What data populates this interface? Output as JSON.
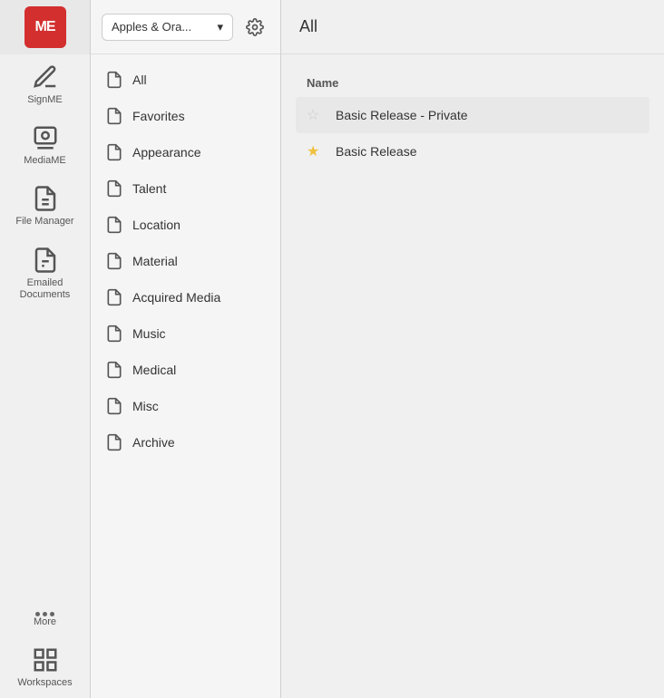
{
  "logo": {
    "text": "ME"
  },
  "sidebar": {
    "items": [
      {
        "id": "sign-me",
        "label": "SignME",
        "icon": "pen"
      },
      {
        "id": "media-me",
        "label": "MediaME",
        "icon": "media"
      },
      {
        "id": "file-manager",
        "label": "File Manager",
        "icon": "file"
      },
      {
        "id": "emailed-documents",
        "label": "Emailed Documents",
        "icon": "email-doc"
      },
      {
        "id": "more",
        "label": "More",
        "icon": "more"
      },
      {
        "id": "workspaces",
        "label": "Workspaces",
        "icon": "grid"
      }
    ]
  },
  "workspace": {
    "name": "Apples & Ora...",
    "settings_label": "settings"
  },
  "menu": {
    "items": [
      {
        "id": "all",
        "label": "All"
      },
      {
        "id": "favorites",
        "label": "Favorites"
      },
      {
        "id": "appearance",
        "label": "Appearance"
      },
      {
        "id": "talent",
        "label": "Talent"
      },
      {
        "id": "location",
        "label": "Location"
      },
      {
        "id": "material",
        "label": "Material"
      },
      {
        "id": "acquired-media",
        "label": "Acquired Media"
      },
      {
        "id": "music",
        "label": "Music"
      },
      {
        "id": "medical",
        "label": "Medical"
      },
      {
        "id": "misc",
        "label": "Misc"
      },
      {
        "id": "archive",
        "label": "Archive"
      }
    ]
  },
  "main": {
    "title": "All",
    "column_name": "Name",
    "rows": [
      {
        "id": "basic-release-private",
        "name": "Basic Release - Private",
        "starred": false,
        "selected": true
      },
      {
        "id": "basic-release",
        "name": "Basic Release",
        "starred": true,
        "selected": false
      }
    ]
  }
}
